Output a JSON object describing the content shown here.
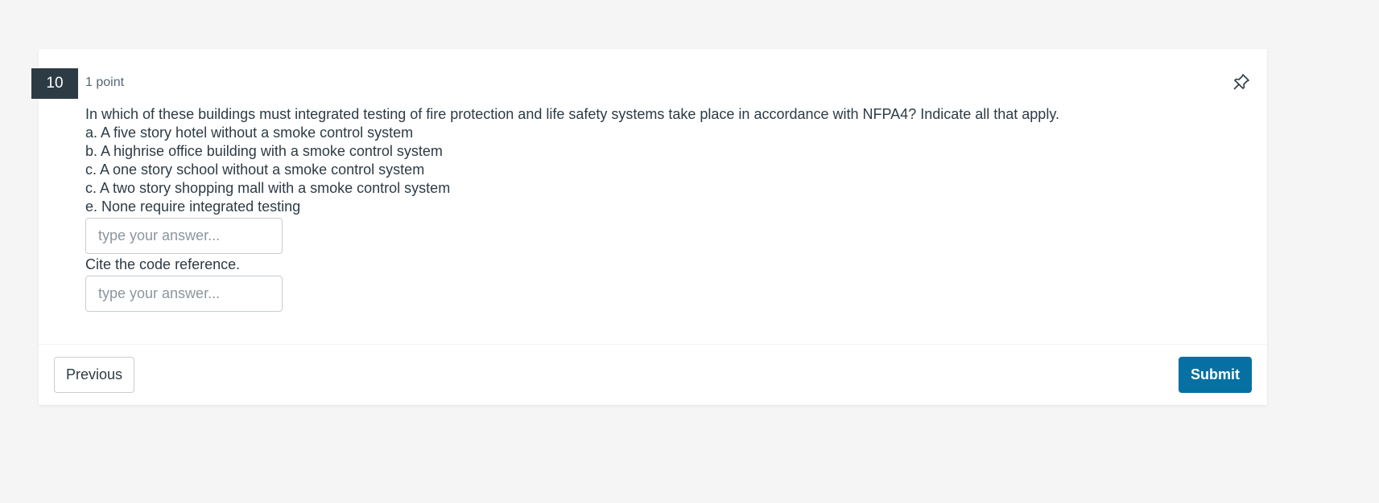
{
  "question": {
    "number": "10",
    "points": "1 point",
    "prompt": "In which of these buildings must integrated testing of fire protection and life safety systems take place in accordance with NFPA4? Indicate all that apply.",
    "options": [
      "a. A five story hotel without a smoke control system",
      "b. A highrise office building with a smoke control system",
      "c. A one story school without a smoke control system",
      "c. A two story shopping mall with a smoke control system",
      "e. None require integrated testing"
    ],
    "answer1": {
      "value": "",
      "placeholder": "type your answer..."
    },
    "followup": "Cite the code reference.",
    "answer2": {
      "value": "",
      "placeholder": "type your answer..."
    }
  },
  "icons": {
    "pin": "pin-icon"
  },
  "navigation": {
    "previous_label": "Previous",
    "submit_label": "Submit"
  },
  "colors": {
    "number_badge": "#2d3b45",
    "submit_button": "#0770a3",
    "background": "#f5f5f5"
  }
}
